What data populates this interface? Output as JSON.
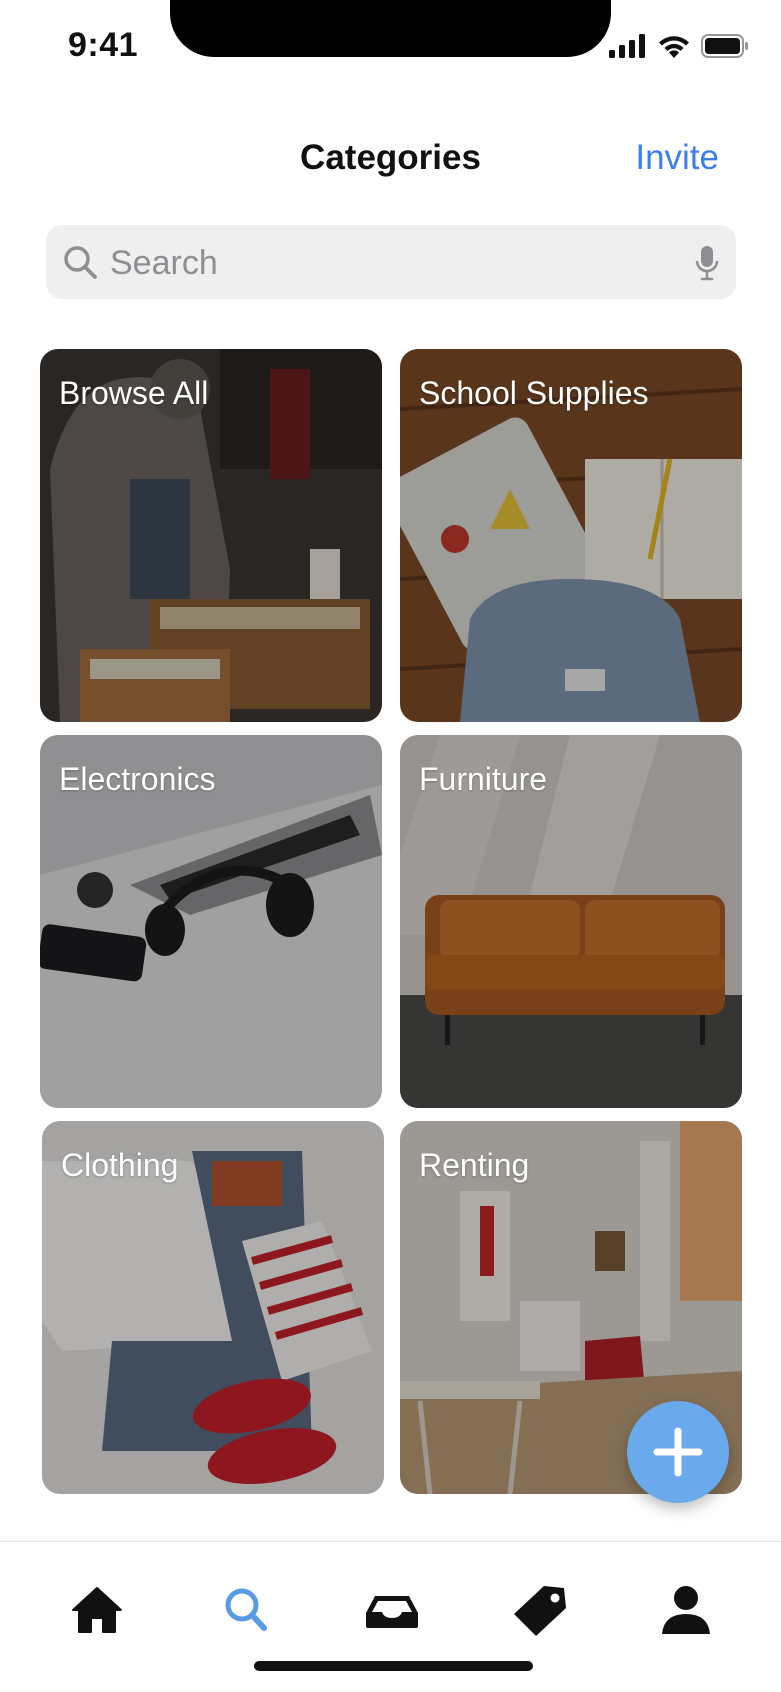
{
  "status": {
    "time": "9:41"
  },
  "header": {
    "title": "Categories",
    "invite_label": "Invite"
  },
  "search": {
    "placeholder": "Search",
    "value": ""
  },
  "categories": [
    {
      "label": "Browse All"
    },
    {
      "label": "School Supplies"
    },
    {
      "label": "Electronics"
    },
    {
      "label": "Furniture"
    },
    {
      "label": "Clothing"
    },
    {
      "label": "Renting"
    }
  ],
  "fab": {
    "icon": "plus-icon"
  },
  "tabs": [
    {
      "icon": "home-icon",
      "active": false
    },
    {
      "icon": "search-icon",
      "active": true
    },
    {
      "icon": "inbox-icon",
      "active": false
    },
    {
      "icon": "tag-icon",
      "active": false
    },
    {
      "icon": "profile-icon",
      "active": false
    }
  ],
  "colors": {
    "accent": "#3d7ff0",
    "fab": "#6aa9ec",
    "active_tab": "#5a9be6"
  }
}
